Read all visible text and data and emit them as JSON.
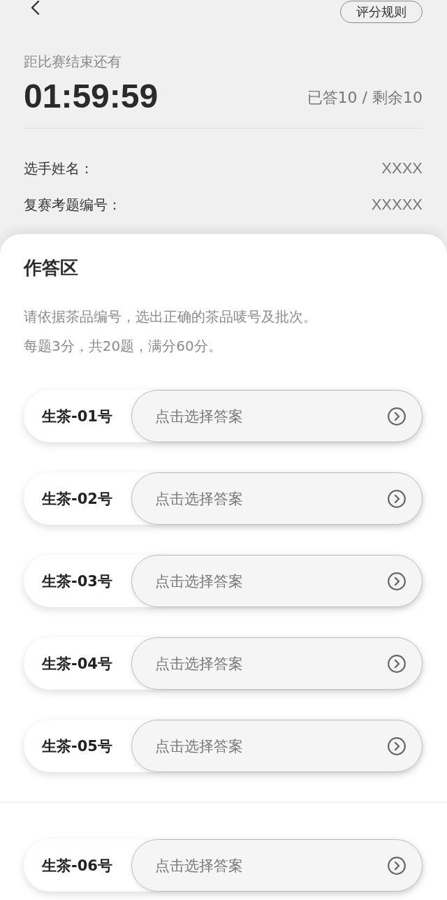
{
  "rules_button": {
    "label": "评分规则"
  },
  "countdown": {
    "label": "距比赛结束还有",
    "time": "01:59:59",
    "progress": "已答10 / 剩余10"
  },
  "contestant_info": [
    {
      "label": "选手姓名：",
      "value": "XXXX"
    },
    {
      "label": "复赛考题编号：",
      "value": "XXXXX"
    }
  ],
  "answer_area": {
    "title": "作答区",
    "instructions": [
      "请依据茶品编号，选出正确的茶品唛号及批次。",
      "每题3分，共20题，满分60分。"
    ],
    "question_groups": [
      {
        "questions": [
          {
            "label": "生茶-01号",
            "placeholder": "点击选择答案"
          },
          {
            "label": "生茶-02号",
            "placeholder": "点击选择答案"
          },
          {
            "label": "生茶-03号",
            "placeholder": "点击选择答案"
          },
          {
            "label": "生茶-04号",
            "placeholder": "点击选择答案"
          },
          {
            "label": "生茶-05号",
            "placeholder": "点击选择答案"
          }
        ]
      },
      {
        "questions": [
          {
            "label": "生茶-06号",
            "placeholder": "点击选择答案"
          }
        ]
      }
    ]
  }
}
